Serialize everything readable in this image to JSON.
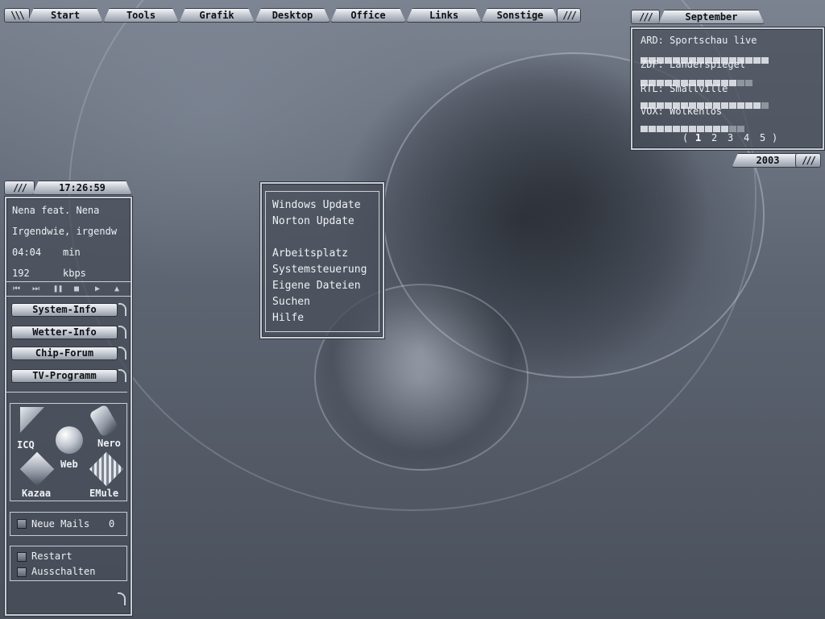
{
  "taskbar": {
    "items": [
      "Start",
      "Tools",
      "Grafik",
      "Desktop",
      "Office",
      "Links",
      "Sonstige"
    ],
    "grip_left": "\\\\\\",
    "grip_right": "///"
  },
  "tv_guide": {
    "month": "September",
    "year": "2003",
    "grip": "///",
    "entries": [
      {
        "text": "ARD: Sportschau live",
        "fill": 0.97
      },
      {
        "text": "ZDF: Länderspiegel",
        "fill": 0.74
      },
      {
        "text": "RTL: Smallville",
        "fill": 0.92
      },
      {
        "text": "VOX: Wolkenlos",
        "fill": 0.67
      }
    ],
    "pages": [
      "(",
      "1",
      "2",
      "3",
      "4",
      "5",
      ")"
    ],
    "active_page": "1"
  },
  "menu": {
    "items": [
      "Windows Update",
      "Norton  Update",
      "",
      "Arbeitsplatz",
      "Systemsteuerung",
      "Eigene Dateien",
      "Suchen",
      "Hilfe"
    ]
  },
  "player": {
    "clock": "17:26:59",
    "grip": "///",
    "artist": "Nena feat. Nena",
    "title": "Irgendwie, irgendw",
    "time": "04:04",
    "time_unit": "min",
    "bitrate": "192",
    "bitrate_unit": "kbps",
    "controls": [
      "prev-icon",
      "next-icon",
      "pause-icon",
      "stop-icon",
      "play-icon",
      "eject-icon"
    ]
  },
  "sidebar": {
    "buttons": [
      "System-Info",
      "Wetter-Info",
      "Chip-Forum",
      "TV-Programm"
    ],
    "shortcuts": [
      {
        "name": "icq",
        "label": "ICQ"
      },
      {
        "name": "web",
        "label": "Web"
      },
      {
        "name": "nero",
        "label": "Nero"
      },
      {
        "name": "kazaa",
        "label": "Kazaa"
      },
      {
        "name": "emule",
        "label": "EMule"
      }
    ],
    "mail_label": "Neue Mails",
    "mail_count": "0",
    "power": [
      "Restart",
      "Ausschalten"
    ]
  },
  "colors": {
    "accent": "#c9ced6",
    "bar_full": "#d4d8de",
    "bar_fade": "#3c424b",
    "panel": "#464c57"
  }
}
